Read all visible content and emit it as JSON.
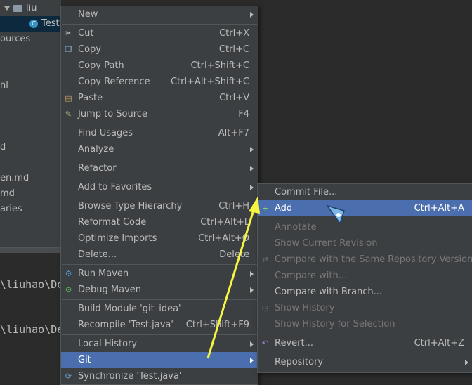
{
  "project_tree": {
    "folder": "liu",
    "file": "Test",
    "fragments": [
      "ources",
      "nl",
      "d",
      "en.md",
      "md",
      "aries"
    ]
  },
  "terminal": {
    "lines": [
      "\\liuhao\\De",
      "\\liuhao\\De"
    ]
  },
  "context_menu": {
    "items": [
      {
        "label": "New",
        "shortcut": "",
        "submenu": true
      },
      {
        "label": "Cut",
        "shortcut": "Ctrl+X",
        "icon": "scissors-icon"
      },
      {
        "label": "Copy",
        "shortcut": "Ctrl+C",
        "icon": "copy-icon"
      },
      {
        "label": "Copy Path",
        "shortcut": "Ctrl+Shift+C"
      },
      {
        "label": "Copy Reference",
        "shortcut": "Ctrl+Alt+Shift+C"
      },
      {
        "label": "Paste",
        "shortcut": "Ctrl+V",
        "icon": "paste-icon"
      },
      {
        "label": "Jump to Source",
        "shortcut": "F4",
        "icon": "jump-to-source-icon"
      },
      {
        "label": "Find Usages",
        "shortcut": "Alt+F7"
      },
      {
        "label": "Analyze",
        "shortcut": "",
        "submenu": true
      },
      {
        "label": "Refactor",
        "shortcut": "",
        "submenu": true
      },
      {
        "label": "Add to Favorites",
        "shortcut": "",
        "submenu": true
      },
      {
        "label": "Browse Type Hierarchy",
        "shortcut": "Ctrl+H"
      },
      {
        "label": "Reformat Code",
        "shortcut": "Ctrl+Alt+L"
      },
      {
        "label": "Optimize Imports",
        "shortcut": "Ctrl+Alt+O"
      },
      {
        "label": "Delete...",
        "shortcut": "Delete"
      },
      {
        "label": "Run Maven",
        "shortcut": "",
        "submenu": true,
        "icon": "maven-gear-icon"
      },
      {
        "label": "Debug Maven",
        "shortcut": "",
        "submenu": true,
        "icon": "maven-debug-icon"
      },
      {
        "label": "Build Module 'git_idea'",
        "shortcut": ""
      },
      {
        "label": "Recompile 'Test.java'",
        "shortcut": "Ctrl+Shift+F9"
      },
      {
        "label": "Local History",
        "shortcut": "",
        "submenu": true
      },
      {
        "label": "Git",
        "shortcut": "",
        "submenu": true,
        "highlighted": true
      },
      {
        "label": "Synchronize 'Test.java'",
        "shortcut": "",
        "icon": "sync-icon"
      }
    ]
  },
  "git_submenu": {
    "items": [
      {
        "label": "Commit File...",
        "shortcut": ""
      },
      {
        "label": "Add",
        "shortcut": "Ctrl+Alt+A",
        "highlighted": true,
        "icon": "add-plus-icon"
      },
      {
        "label": "Annotate",
        "shortcut": "",
        "disabled": true
      },
      {
        "label": "Show Current Revision",
        "shortcut": "",
        "disabled": true
      },
      {
        "label": "Compare with the Same Repository Version",
        "shortcut": "",
        "disabled": true,
        "icon": "compare-icon"
      },
      {
        "label": "Compare with...",
        "shortcut": "",
        "disabled": true
      },
      {
        "label": "Compare with Branch...",
        "shortcut": ""
      },
      {
        "label": "Show History",
        "shortcut": "",
        "disabled": true,
        "icon": "history-icon"
      },
      {
        "label": "Show History for Selection",
        "shortcut": "",
        "disabled": true
      },
      {
        "label": "Revert...",
        "shortcut": "Ctrl+Alt+Z",
        "icon": "revert-icon"
      },
      {
        "label": "Repository",
        "shortcut": "",
        "submenu": true
      }
    ]
  },
  "colors": {
    "menu_bg": "#3c3f41",
    "highlight": "#4b6eaf",
    "annotation_arrow": "#f5f542"
  }
}
